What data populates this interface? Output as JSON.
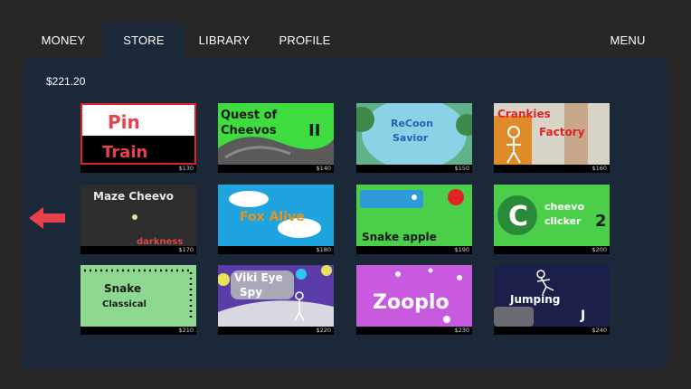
{
  "nav": {
    "tabs": [
      {
        "label": "MONEY",
        "active": false
      },
      {
        "label": "STORE",
        "active": true
      },
      {
        "label": "LIBRARY",
        "active": false
      },
      {
        "label": "PROFILE",
        "active": false
      }
    ],
    "menu_label": "MENU"
  },
  "store": {
    "balance": "$221.20",
    "games": [
      {
        "title_lines": [
          "Pin",
          "Train"
        ],
        "price": "$130"
      },
      {
        "title_lines": [
          "Quest of",
          "Cheevos",
          "II"
        ],
        "price": "$140"
      },
      {
        "title_lines": [
          "ReCoon",
          "Savior"
        ],
        "price": "$150"
      },
      {
        "title_lines": [
          "Crankies",
          "Factory"
        ],
        "price": "$160"
      },
      {
        "title_lines": [
          "Maze Cheevo",
          "darkness"
        ],
        "price": "$170"
      },
      {
        "title_lines": [
          "Fox Alive"
        ],
        "price": "$180"
      },
      {
        "title_lines": [
          "Snake apple"
        ],
        "price": "$190"
      },
      {
        "title_lines": [
          "C",
          "cheevo",
          "clicker",
          "2"
        ],
        "price": "$200"
      },
      {
        "title_lines": [
          "Snake",
          "Classical"
        ],
        "price": "$210"
      },
      {
        "title_lines": [
          "Viki Eye",
          "Spy"
        ],
        "price": "$220"
      },
      {
        "title_lines": [
          "Zooplo"
        ],
        "price": "$230"
      },
      {
        "title_lines": [
          "Jumping",
          "J"
        ],
        "price": "$240"
      }
    ]
  },
  "colors": {
    "background": "#262626",
    "panel": "#1b2838",
    "arrow": "#e8414d"
  },
  "icons": {
    "back": "left-arrow-icon"
  }
}
